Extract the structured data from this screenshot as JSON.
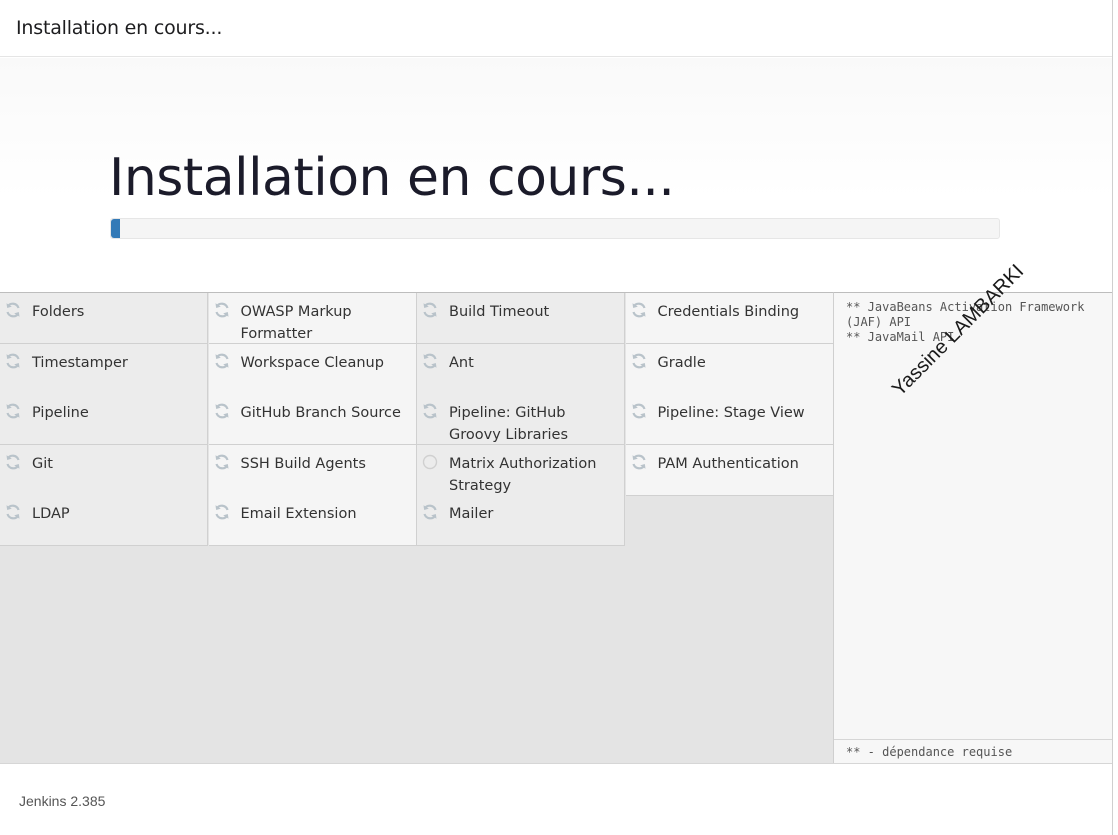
{
  "header": {
    "title": "Installation en cours..."
  },
  "main": {
    "heading": "Installation en cours...",
    "progress_percent": 1
  },
  "plugins": [
    {
      "name": "Folders",
      "status": "installing"
    },
    {
      "name": "OWASP Markup Formatter",
      "status": "installing"
    },
    {
      "name": "Build Timeout",
      "status": "installing"
    },
    {
      "name": "Credentials Binding",
      "status": "installing"
    },
    {
      "name": "Timestamper",
      "status": "installing"
    },
    {
      "name": "Workspace Cleanup",
      "status": "installing"
    },
    {
      "name": "Ant",
      "status": "installing"
    },
    {
      "name": "Gradle",
      "status": "installing"
    },
    {
      "name": "Pipeline",
      "status": "installing"
    },
    {
      "name": "GitHub Branch Source",
      "status": "installing"
    },
    {
      "name": "Pipeline: GitHub Groovy Libraries",
      "status": "installing"
    },
    {
      "name": "Pipeline: Stage View",
      "status": "installing"
    },
    {
      "name": "Git",
      "status": "installing"
    },
    {
      "name": "SSH Build Agents",
      "status": "installing"
    },
    {
      "name": "Matrix Authorization Strategy",
      "status": "pending"
    },
    {
      "name": "PAM Authentication",
      "status": "installing"
    },
    {
      "name": "LDAP",
      "status": "installing"
    },
    {
      "name": "Email Extension",
      "status": "installing"
    },
    {
      "name": "Mailer",
      "status": "installing"
    }
  ],
  "side_panel": {
    "log": "** JavaBeans Activation Framework (JAF) API\n** JavaMail API",
    "watermark": "Yassine LAMBARKI",
    "footer_note": "** - dépendance requise"
  },
  "footer": {
    "version": "Jenkins 2.385"
  },
  "icons": {
    "installing": "refresh-icon",
    "pending": "circle-icon"
  },
  "colors": {
    "progress": "#337ab7",
    "icon": "#b9c3ca"
  }
}
